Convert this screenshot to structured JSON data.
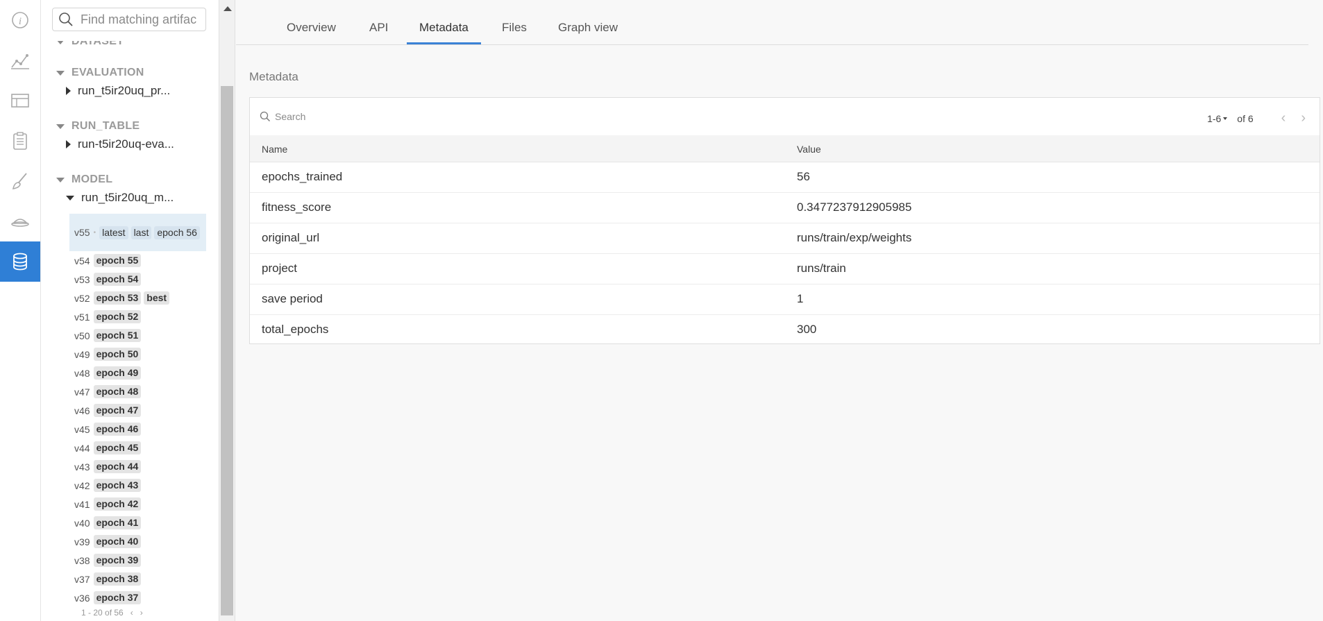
{
  "rail": {
    "icons": [
      "info-icon",
      "line-chart-icon",
      "table-icon",
      "clipboard-icon",
      "brush-icon",
      "sweep-icon",
      "database-icon"
    ],
    "active_index": 6,
    "accent": "#2f7fd6"
  },
  "sidebar": {
    "search_placeholder": "Find matching artifac",
    "sections": {
      "dataset": "DATASET",
      "evaluation": "EVALUATION",
      "run_table": "RUN_TABLE",
      "model": "MODEL"
    },
    "artifacts": {
      "evaluation_item": "run_t5ir20uq_pr...",
      "run_table_item": "run-t5ir20uq-eva...",
      "model_item": "run_t5ir20uq_m..."
    },
    "selected_version": {
      "version": "v55",
      "tags": [
        "latest",
        "last",
        "epoch 56"
      ]
    },
    "versions": [
      {
        "version": "v54",
        "tags": [
          "epoch 55"
        ]
      },
      {
        "version": "v53",
        "tags": [
          "epoch 54"
        ]
      },
      {
        "version": "v52",
        "tags": [
          "epoch 53",
          "best"
        ]
      },
      {
        "version": "v51",
        "tags": [
          "epoch 52"
        ]
      },
      {
        "version": "v50",
        "tags": [
          "epoch 51"
        ]
      },
      {
        "version": "v49",
        "tags": [
          "epoch 50"
        ]
      },
      {
        "version": "v48",
        "tags": [
          "epoch 49"
        ]
      },
      {
        "version": "v47",
        "tags": [
          "epoch 48"
        ]
      },
      {
        "version": "v46",
        "tags": [
          "epoch 47"
        ]
      },
      {
        "version": "v45",
        "tags": [
          "epoch 46"
        ]
      },
      {
        "version": "v44",
        "tags": [
          "epoch 45"
        ]
      },
      {
        "version": "v43",
        "tags": [
          "epoch 44"
        ]
      },
      {
        "version": "v42",
        "tags": [
          "epoch 43"
        ]
      },
      {
        "version": "v41",
        "tags": [
          "epoch 42"
        ]
      },
      {
        "version": "v40",
        "tags": [
          "epoch 41"
        ]
      },
      {
        "version": "v39",
        "tags": [
          "epoch 40"
        ]
      },
      {
        "version": "v38",
        "tags": [
          "epoch 39"
        ]
      },
      {
        "version": "v37",
        "tags": [
          "epoch 38"
        ]
      },
      {
        "version": "v36",
        "tags": [
          "epoch 37"
        ]
      }
    ],
    "pager": {
      "label": "1 - 20 of 56",
      "prev": "‹",
      "next": "›"
    }
  },
  "tabs": {
    "overview": "Overview",
    "api": "API",
    "metadata": "Metadata",
    "files": "Files",
    "graph_view": "Graph view",
    "active": "Metadata"
  },
  "metadata": {
    "heading": "Metadata",
    "search_placeholder": "Search",
    "pager_range": "1-6",
    "pager_total": "of 6",
    "prev": "‹",
    "next": "›",
    "columns": {
      "name": "Name",
      "value": "Value"
    },
    "rows": [
      {
        "name": "epochs_trained",
        "value": "56"
      },
      {
        "name": "fitness_score",
        "value": "0.3477237912905985"
      },
      {
        "name": "original_url",
        "value": "runs/train/exp/weights"
      },
      {
        "name": "project",
        "value": "runs/train"
      },
      {
        "name": "save period",
        "value": "1"
      },
      {
        "name": "total_epochs",
        "value": "300"
      }
    ]
  }
}
